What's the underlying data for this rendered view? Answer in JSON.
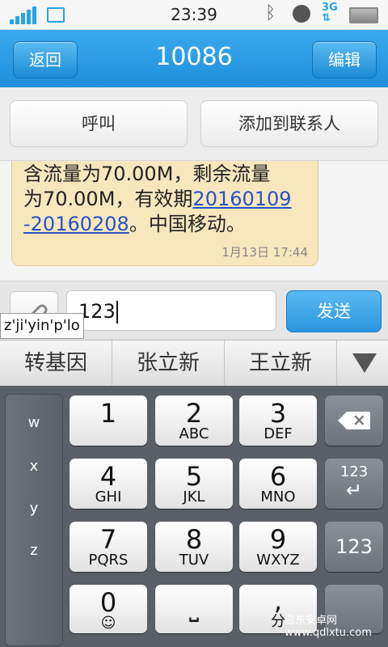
{
  "status": {
    "time": "23:39",
    "network": "3G",
    "signal_level": 1.0,
    "icons": [
      "signal-icon",
      "image-icon",
      "bluetooth-icon",
      "alarm-icon",
      "network-3g-icon",
      "battery-icon"
    ]
  },
  "header": {
    "title": "10086",
    "back_label": "返回",
    "edit_label": "编辑"
  },
  "actions": {
    "call_label": "呼叫",
    "add_contact_label": "添加到联系人"
  },
  "message": {
    "line1": "含流量为70.00M，剩余流量",
    "line2_pre": "为70.00M，有效期",
    "link_part1": "20160109",
    "link_part2": "-20160208",
    "line3_post": "。中国移动。",
    "timestamp": "1月13日 17:44"
  },
  "compose": {
    "input_value": "123",
    "send_label": "发送"
  },
  "ime": {
    "pinyin": "z'ji'yin'p'lo",
    "candidates": [
      "转基因",
      "张立新",
      "王立新"
    ],
    "side_letters": [
      "w",
      "x",
      "y",
      "z"
    ],
    "keys": [
      {
        "num": "1",
        "letters": ""
      },
      {
        "num": "2",
        "letters": "ABC"
      },
      {
        "num": "3",
        "letters": "DEF"
      },
      {
        "num": "4",
        "letters": "GHI"
      },
      {
        "num": "5",
        "letters": "JKL"
      },
      {
        "num": "6",
        "letters": "MNO"
      },
      {
        "num": "7",
        "letters": "PQRS"
      },
      {
        "num": "8",
        "letters": "TUV"
      },
      {
        "num": "9",
        "letters": "WXYZ"
      },
      {
        "num": "0",
        "letters": "☺"
      }
    ],
    "enter_top": "123",
    "mode_label": "123",
    "space_symbol": "⎵",
    "bottom_right_label": "分"
  },
  "watermark": "启东安卓网 www.qdlxtu.com",
  "colors": {
    "header": "#2196e0",
    "bubble": "#f6e7bd",
    "link": "#2a52c7",
    "keyboard_bg": "#5b5f66"
  }
}
